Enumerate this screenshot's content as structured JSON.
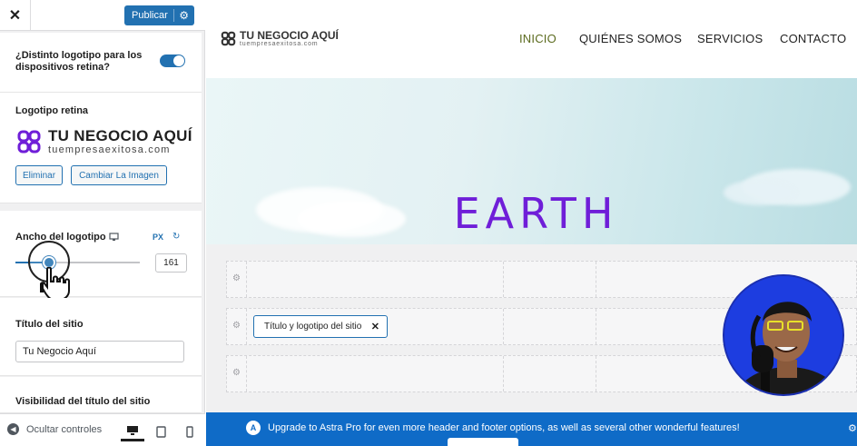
{
  "sidebar": {
    "close_label": "✕",
    "publish_label": "Publicar",
    "retina_toggle_label": "¿Distinto logotipo para los dispositivos retina?",
    "retina_logo_heading": "Logotipo retina",
    "logo_name": "TU NEGOCIO AQUÍ",
    "logo_url": "tuempresaexitosa.com",
    "remove_label": "Eliminar",
    "change_image_label": "Cambiar La Imagen",
    "logo_width_label": "Ancho del logotipo",
    "unit_label": "PX",
    "logo_width_value": "161",
    "logo_width_min": 0,
    "logo_width_max": 600,
    "site_title_label": "Título del sitio",
    "site_title_value": "Tu Negocio Aquí",
    "site_title_visibility_label": "Visibilidad del título del sitio",
    "hide_controls_label": "Ocultar controles"
  },
  "preview": {
    "logo_name": "TU NEGOCIO AQUÍ",
    "logo_url": "tuempresaexitosa.com",
    "nav": [
      "INICIO",
      "QUIÉNES SOMOS",
      "SERVICIOS",
      "CONTACTO"
    ],
    "hero_title": "EARTH",
    "chip_label": "Título y logotipo del sitio",
    "upgrade_message": "Upgrade to Astra Pro for even more header and footer options, as well as several other wonderful features!"
  },
  "colors": {
    "accent": "#2271b1",
    "hero_text": "#6f1ed8",
    "active_nav": "#5c6b1f",
    "upgrade_bar": "#0f6bc7"
  }
}
